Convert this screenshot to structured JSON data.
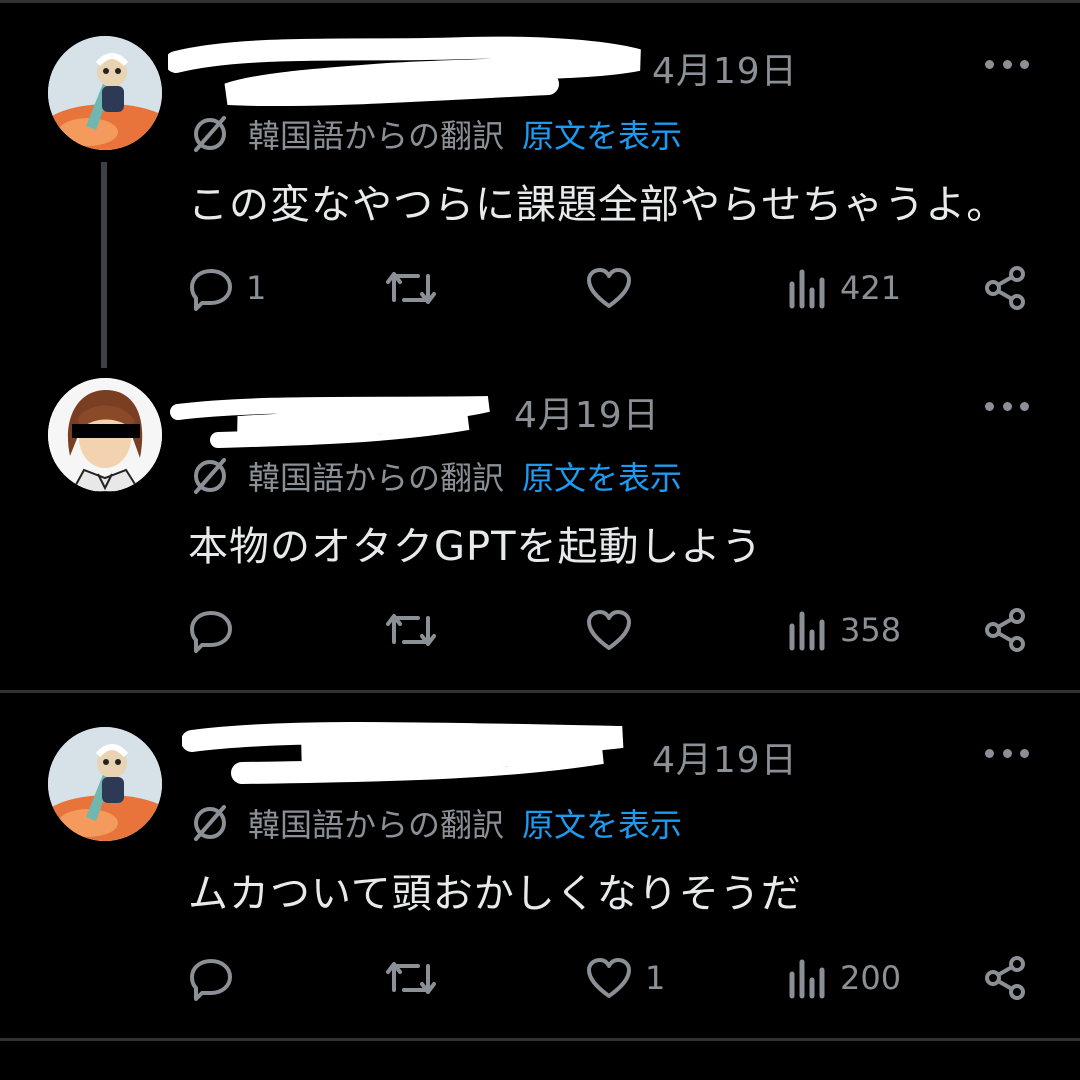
{
  "posts": [
    {
      "date": "4月19日",
      "translation_label": "韓国語からの翻訳",
      "show_original": "原文を表示",
      "text": "この変なやつらに課題全部やらせちゃうよ。",
      "reply_count": "1",
      "retweet_count": "",
      "like_count": "",
      "view_count": "421"
    },
    {
      "date": "4月19日",
      "translation_label": "韓国語からの翻訳",
      "show_original": "原文を表示",
      "text": "本物のオタクGPTを起動しよう",
      "reply_count": "",
      "retweet_count": "",
      "like_count": "",
      "view_count": "358"
    },
    {
      "date": "4月19日",
      "translation_label": "韓国語からの翻訳",
      "show_original": "原文を表示",
      "text": "ムカついて頭おかしくなりそうだ",
      "reply_count": "",
      "retweet_count": "",
      "like_count": "1",
      "view_count": "200"
    }
  ],
  "icons": {
    "reply": "reply-icon",
    "retweet": "retweet-icon",
    "like": "heart-icon",
    "views": "views-icon",
    "share": "share-icon",
    "more": "more-icon",
    "translate": "translate-icon"
  },
  "colors": {
    "background": "#000000",
    "text": "#e7e9ea",
    "muted": "#8b9096",
    "link": "#1d9bf0",
    "divider": "#2f3336"
  }
}
